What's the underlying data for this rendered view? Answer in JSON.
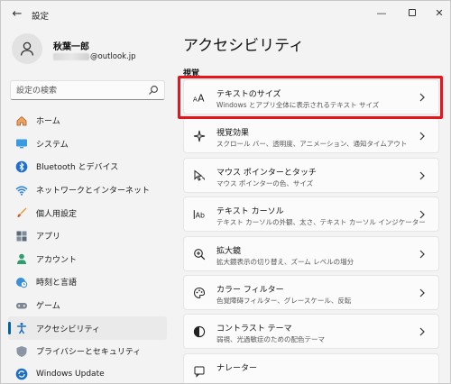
{
  "window": {
    "title": "設定",
    "back_glyph": "←",
    "minimize_glyph": "—",
    "close_glyph": "✕"
  },
  "user": {
    "name": "秋葉一郎",
    "email_suffix": "@outlook.jp"
  },
  "search": {
    "placeholder": "設定の検索"
  },
  "sidebar": {
    "items": [
      {
        "label": "ホーム",
        "icon": "home-icon"
      },
      {
        "label": "システム",
        "icon": "system-icon"
      },
      {
        "label": "Bluetooth とデバイス",
        "icon": "bluetooth-icon"
      },
      {
        "label": "ネットワークとインターネット",
        "icon": "wifi-icon"
      },
      {
        "label": "個人用設定",
        "icon": "brush-icon"
      },
      {
        "label": "アプリ",
        "icon": "apps-icon"
      },
      {
        "label": "アカウント",
        "icon": "account-icon"
      },
      {
        "label": "時刻と言語",
        "icon": "globe-clock-icon"
      },
      {
        "label": "ゲーム",
        "icon": "gamepad-icon"
      },
      {
        "label": "アクセシビリティ",
        "icon": "accessibility-icon",
        "active": true
      },
      {
        "label": "プライバシーとセキュリティ",
        "icon": "shield-icon"
      },
      {
        "label": "Windows Update",
        "icon": "update-icon"
      }
    ]
  },
  "main": {
    "title": "アクセシビリティ",
    "section": "視覚",
    "cards": [
      {
        "title": "テキストのサイズ",
        "desc": "Windows とアプリ全体に表示されるテキスト サイズ",
        "icon": "text-size-icon",
        "highlighted": true
      },
      {
        "title": "視覚効果",
        "desc": "スクロール バー、透明度、アニメーション、通知タイムアウト",
        "icon": "sparkle-icon"
      },
      {
        "title": "マウス ポインターとタッチ",
        "desc": "マウス ポインターの色、サイズ",
        "icon": "mouse-pointer-icon"
      },
      {
        "title": "テキスト カーソル",
        "desc": "テキスト カーソルの外観、太さ、テキスト カーソル インジケーター",
        "icon": "text-cursor-icon"
      },
      {
        "title": "拡大鏡",
        "desc": "拡大鏡表示の切り替え、ズーム レベルの増分",
        "icon": "magnifier-icon"
      },
      {
        "title": "カラー フィルター",
        "desc": "色覚障碍フィルター、グレースケール、反転",
        "icon": "color-filter-icon"
      },
      {
        "title": "コントラスト テーマ",
        "desc": "弱視、光過敏症のための配色テーマ",
        "icon": "contrast-icon"
      },
      {
        "title": "ナレーター",
        "desc": "",
        "icon": "narrator-icon"
      }
    ]
  },
  "colors": {
    "accent": "#005fb8",
    "highlight": "#e8141b"
  }
}
